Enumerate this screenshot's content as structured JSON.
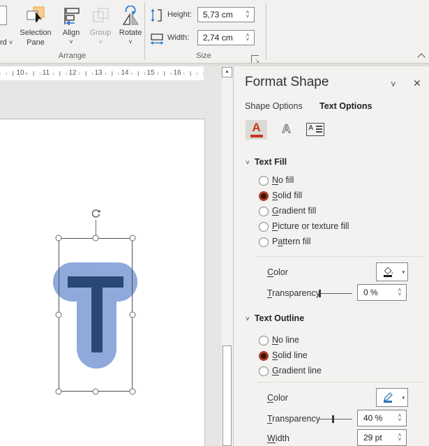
{
  "icons": {
    "spin_up": "˄",
    "spin_down": "˅",
    "dropdown": "▾",
    "scroll_up": "▲",
    "close": "✕",
    "panel_chevron": "˅",
    "section_chevron": "˅",
    "dialog_launcher": "↘"
  },
  "ribbon": {
    "partial_button": {
      "label": "rd",
      "chevron": "˅"
    },
    "selection_pane": {
      "line1": "Selection",
      "line2": "Pane"
    },
    "align": {
      "label": "Align",
      "chevron": "˅"
    },
    "group": {
      "label": "Group",
      "chevron": "˅"
    },
    "rotate": {
      "label": "Rotate",
      "chevron": "˅"
    },
    "arrange_label": "Arrange",
    "size": {
      "height_label": "Height:",
      "height_value": "5,73 cm",
      "width_label": "Width:",
      "width_value": "2,74 cm",
      "group_label": "Size"
    }
  },
  "canvas": {
    "ruler_numbers": [
      "10",
      "11",
      "12",
      "13",
      "14",
      "15",
      "16"
    ],
    "shape": {
      "letter": "T",
      "fill_color": "#2A4875",
      "outline_color": "#8FA9DB"
    }
  },
  "panel": {
    "title": "Format Shape",
    "tabs": {
      "shape_options": "Shape Options",
      "text_options": "Text Options"
    },
    "text_fill": {
      "title": "Text Fill",
      "options": [
        {
          "pre": "",
          "accel": "N",
          "post": "o fill",
          "selected": false
        },
        {
          "pre": "",
          "accel": "S",
          "post": "olid fill",
          "selected": true
        },
        {
          "pre": "",
          "accel": "G",
          "post": "radient fill",
          "selected": false
        },
        {
          "pre": "",
          "accel": "P",
          "post": "icture or texture fill",
          "selected": false
        },
        {
          "pre": "P",
          "accel": "a",
          "post": "ttern fill",
          "selected": false
        }
      ],
      "color_label": {
        "accel": "C",
        "post": "olor"
      },
      "transparency_label": {
        "accel": "T",
        "post": "ransparency"
      },
      "transparency_value": "0 %",
      "transparency_percent": 0
    },
    "text_outline": {
      "title": "Text Outline",
      "options": [
        {
          "pre": "",
          "accel": "N",
          "post": "o line",
          "selected": false
        },
        {
          "pre": "",
          "accel": "S",
          "post": "olid line",
          "selected": true
        },
        {
          "pre": "",
          "accel": "G",
          "post": "radient line",
          "selected": false
        }
      ],
      "color_label": {
        "accel": "C",
        "post": "olor"
      },
      "transparency_label": {
        "accel": "T",
        "post": "ransparency"
      },
      "transparency_value": "40 %",
      "transparency_percent": 40,
      "width_label": {
        "accel": "W",
        "post": "idth"
      },
      "width_value": "29 pt"
    }
  }
}
